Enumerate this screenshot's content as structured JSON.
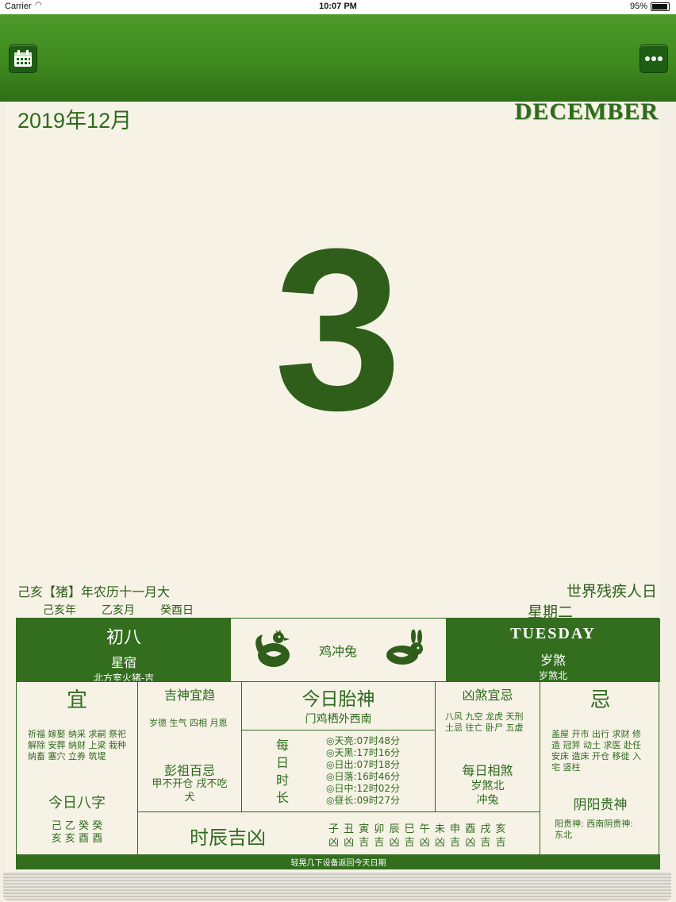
{
  "status": {
    "carrier": "Carrier",
    "time": "10:07 PM",
    "battery": "95%",
    "battery_level": 0.95
  },
  "header": {
    "left_icon": "calendar-icon",
    "right_icon": "more-icon"
  },
  "date": {
    "year_month": "2019年12月",
    "month_en": "DECEMBER",
    "day": "3"
  },
  "lunar": {
    "line": "己亥【猪】年农历十一月大",
    "ganzhi_year": "己亥年",
    "ganzhi_month": "乙亥月",
    "ganzhi_day": "癸酉日"
  },
  "festival": "世界残疾人日",
  "weekday": "星期二",
  "left_top": {
    "lunar_day": "初八",
    "star_label": "星宿",
    "star_value": "北方室火猪-吉"
  },
  "center_top": {
    "clash": "鸡冲兔"
  },
  "right_top": {
    "weekday_en": "TUESDAY",
    "sui_sha": "岁煞",
    "sui_sha_dir": "岁煞北"
  },
  "yi": {
    "title": "宜",
    "items": "祈福 嫁娶 纳采 求嗣 祭祀 解除 安葬 纳财 上梁 栽种 纳畜 塞穴 立券 筑堤"
  },
  "bazi": {
    "title": "今日八字",
    "line1": "己 乙 癸 癸",
    "line2": "亥 亥 酉 酉"
  },
  "jishen": {
    "title": "吉神宜趋",
    "items": "岁德 生气 四相 月恩"
  },
  "pengzu": {
    "title": "彭祖百忌",
    "text": "甲不开仓 戌不吃犬"
  },
  "taishen": {
    "title": "今日胎神",
    "text": "门鸡栖外西南"
  },
  "daylength": {
    "title": "每日时长",
    "items": [
      "◎天亮:07时48分",
      "◎天黑:17时16分",
      "◎日出:07时18分",
      "◎日落:16时46分",
      "◎日中:12时02分",
      "◎昼长:09时27分"
    ]
  },
  "xiongsha": {
    "title": "凶煞宜忌",
    "items": "八风 九空 龙虎 天刑 土忌 往亡 卧尸 五虚"
  },
  "xiangsha": {
    "title": "每日相煞",
    "line1": "岁煞北",
    "line2": "冲兔"
  },
  "ji": {
    "title": "忌",
    "items": "盖屋 开市 出行 求财 修造 冠笄 动土 求医 赴任 安床 造床 开仓 移徙 入宅 竖柱"
  },
  "guishen": {
    "title": "阴阳贵神",
    "text": "阳贵神: 西南阴贵神: 东北"
  },
  "shichen": {
    "title": "时辰吉凶",
    "branches": "子 丑 寅 卯 辰 巳 午 未 申 酉 戌 亥",
    "fortunes": "凶 凶 吉 吉 凶 吉 凶 凶 吉 凶 吉 吉"
  },
  "footer": "轻晃几下设备返回今天日期",
  "colors": {
    "green": "#336e1f",
    "header": "#3f8a1f",
    "paper": "#f6f2e6"
  }
}
